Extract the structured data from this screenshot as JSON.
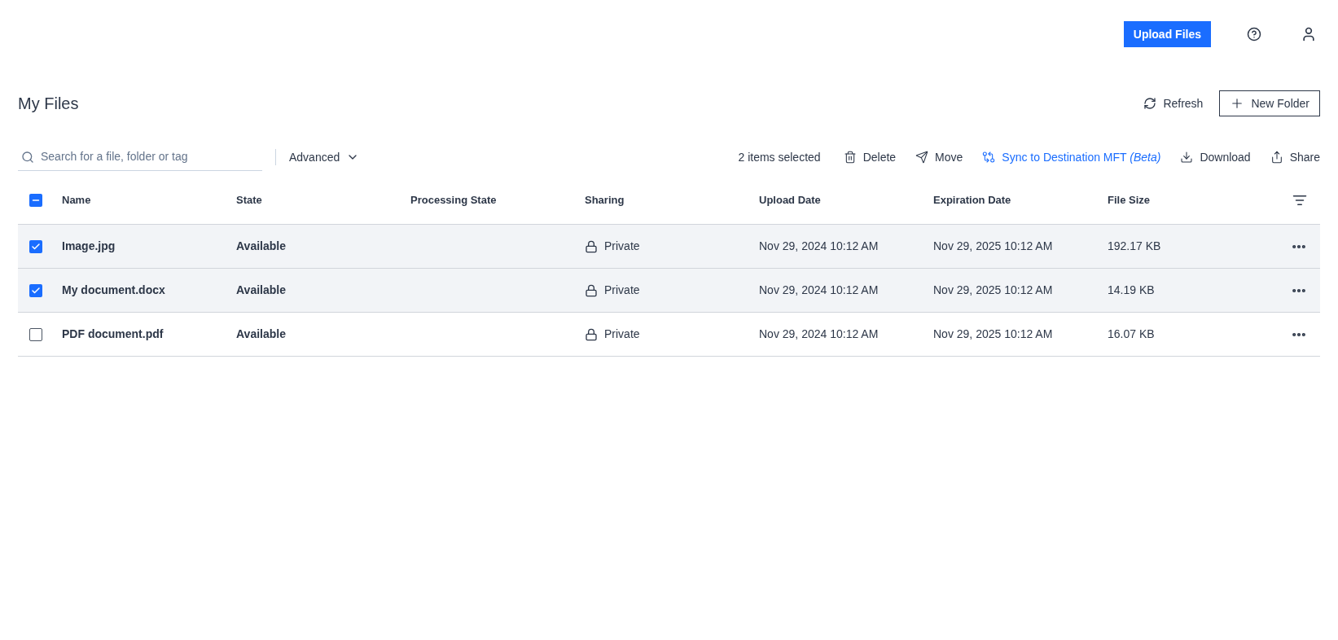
{
  "header": {
    "upload_button": "Upload Files"
  },
  "title": "My Files",
  "title_actions": [
    {
      "kind": "refresh",
      "label": "Refresh"
    },
    {
      "kind": "new-folder",
      "label": "New Folder"
    }
  ],
  "search": {
    "placeholder": "Search for a file, folder or tag"
  },
  "advanced": "Advanced",
  "selection_count": "2 items selected",
  "actions": [
    {
      "kind": "delete",
      "label": "Delete",
      "accent": false
    },
    {
      "kind": "move",
      "label": "Move",
      "accent": false
    },
    {
      "kind": "sync",
      "label": "Sync to Destination MFT *(Beta)*",
      "accent": true
    },
    {
      "kind": "download",
      "label": "Download",
      "accent": false
    },
    {
      "kind": "share",
      "label": "Share",
      "accent": false
    }
  ],
  "table": {
    "select_all": {
      "checked": true,
      "partial": true
    },
    "columns": [
      "Name",
      "State",
      "Processing State",
      "Sharing",
      "Upload Date",
      "Expiration Date",
      "File Size"
    ],
    "rows": [
      {
        "selected": true,
        "name": "Image.jpg",
        "state": "Available",
        "sharing": "Private",
        "upload_date": "Nov 29, 2024 10:12 AM",
        "expiration_date": "Nov 29, 2025 10:12 AM",
        "file_size": "192.17 KB"
      },
      {
        "selected": true,
        "name": "My document.docx",
        "state": "Available",
        "sharing": "Private",
        "upload_date": "Nov 29, 2024 10:12 AM",
        "expiration_date": "Nov 29, 2025 10:12 AM",
        "file_size": "14.19 KB"
      },
      {
        "selected": false,
        "name": "PDF document.pdf",
        "state": "Available",
        "sharing": "Private",
        "upload_date": "Nov 29, 2024 10:12 AM",
        "expiration_date": "Nov 29, 2025 10:12 AM",
        "file_size": "16.07 KB"
      }
    ]
  }
}
